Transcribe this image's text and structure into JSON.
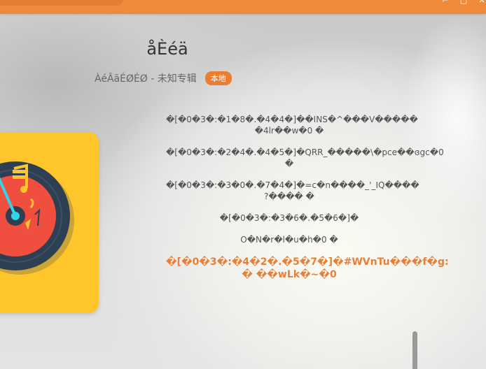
{
  "window": {
    "controls": [
      "⌐",
      "▢",
      "✕"
    ]
  },
  "song": {
    "title": "åÈéä",
    "artist_album": "ÀéÂãÉØÉØ - 未知专辑",
    "source_badge": "本地"
  },
  "lyrics": {
    "lines": [
      "�[�0�3�:�1�8�.�4�4�]��INS�^���V����� �4lr��w�0 �",
      "�[�0�3�:�2�4�.�4�5�]�QRR_�����\\�pce��ɞgc�0 �",
      "�[�0�3�:�3�0�.�7�4�]�=c�n����_'_IQ���� ?���� �",
      "�[�0�3�:�3�6�.�5�6�]�",
      "O�N�r�l�u�h�0 �"
    ],
    "current_line": "�[�0�3�:�4�2�.�5�7�]�#WVnTu���f�g: � ��wLk�~�0"
  },
  "colors": {
    "accent": "#ea7e33",
    "titlebar": "#f08a3a",
    "cover_bg": "#ffc62c",
    "disc_dark": "#2f3f52",
    "disc_red": "#f04e3e",
    "needle_cyan": "#30d6e6"
  }
}
